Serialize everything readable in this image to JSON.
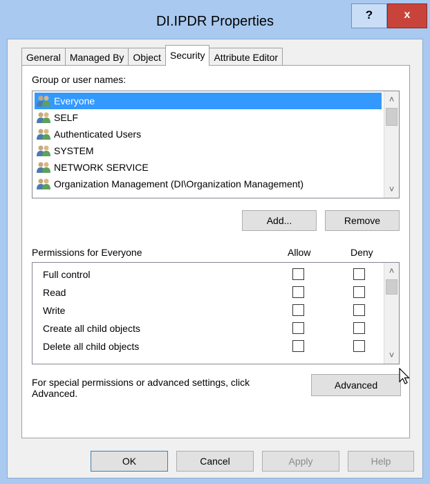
{
  "window": {
    "title": "DI.IPDR Properties",
    "help_label": "?",
    "close_label": "x"
  },
  "tabs": [
    {
      "label": "General"
    },
    {
      "label": "Managed By"
    },
    {
      "label": "Object"
    },
    {
      "label": "Security",
      "active": true
    },
    {
      "label": "Attribute Editor"
    }
  ],
  "security": {
    "group_label": "Group or user names:",
    "users": [
      {
        "name": "Everyone",
        "selected": true
      },
      {
        "name": "SELF"
      },
      {
        "name": "Authenticated Users"
      },
      {
        "name": "SYSTEM"
      },
      {
        "name": "NETWORK SERVICE"
      },
      {
        "name": "Organization Management (DI\\Organization Management)"
      }
    ],
    "add_label": "Add...",
    "remove_label": "Remove",
    "permissions_label": "Permissions for Everyone",
    "allow_label": "Allow",
    "deny_label": "Deny",
    "permissions": [
      {
        "name": "Full control",
        "allow": false,
        "deny": false
      },
      {
        "name": "Read",
        "allow": false,
        "deny": false
      },
      {
        "name": "Write",
        "allow": false,
        "deny": false
      },
      {
        "name": "Create all child objects",
        "allow": false,
        "deny": false
      },
      {
        "name": "Delete all child objects",
        "allow": false,
        "deny": false
      }
    ],
    "advanced_text": "For special permissions or advanced settings, click Advanced.",
    "advanced_label": "Advanced"
  },
  "footer": {
    "ok_label": "OK",
    "cancel_label": "Cancel",
    "apply_label": "Apply",
    "help_label": "Help"
  },
  "colors": {
    "titlebar": "#a9c9f0",
    "selection": "#3399ff",
    "close": "#c8443a"
  }
}
